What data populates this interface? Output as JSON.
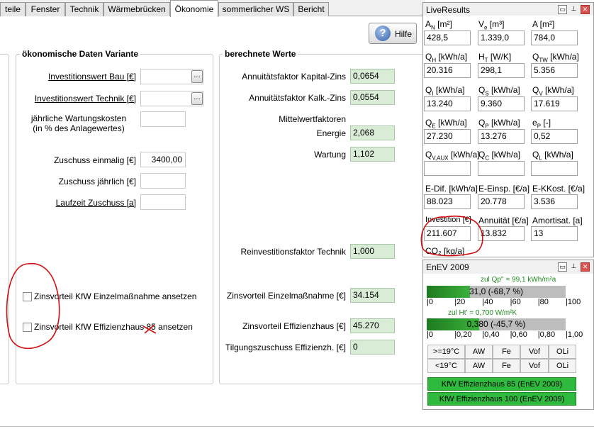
{
  "tabs": [
    "teile",
    "Fenster",
    "Technik",
    "Wärmebrücken",
    "Ökonomie",
    "sommerlicher WS",
    "Bericht"
  ],
  "help_label": "Hilfe",
  "left_group": {
    "title": "ökonomische Daten Variante",
    "investition_bau": {
      "label": "Investitionswert Bau [€]",
      "value": ""
    },
    "investition_technik": {
      "label": "Investitionswert Technik [€]",
      "value": ""
    },
    "wartung": {
      "label_line1": "jährliche Wartungskosten",
      "label_line2": "(in % des Anlagewertes)",
      "value": ""
    },
    "zuschuss_einmalig": {
      "label": "Zuschuss einmalig [€]",
      "value": "3400,00"
    },
    "zuschuss_jaehrlich": {
      "label": "Zuschuss jährlich [€]",
      "value": ""
    },
    "laufzeit": {
      "label": "Laufzeit Zuschuss [a]",
      "value": ""
    },
    "chk_einzel": "Zinsvorteil KfW Einzelmaßnahme ansetzen",
    "chk_effizienz": "Zinsvorteil KfW Effizienzhaus 85 ansetzen"
  },
  "right_group": {
    "title": "berechnete Werte",
    "annuitaet_kapital": {
      "label": "Annuitätsfaktor Kapital-Zins",
      "value": "0,0654"
    },
    "annuitaet_kalk": {
      "label": "Annuitätsfaktor Kalk.-Zins",
      "value": "0,0554"
    },
    "mittelwert_label": "Mittelwertfaktoren",
    "energie": {
      "label": "Energie",
      "value": "2,068"
    },
    "wartung": {
      "label": "Wartung",
      "value": "1,102"
    },
    "reinvest": {
      "label": "Reinvestitionsfaktor Technik",
      "value": "1,000"
    },
    "zins_einzel": {
      "label": "Zinsvorteil Einzelmaßnahme [€]",
      "value": "34.154"
    },
    "zins_effizienz": {
      "label": "Zinsvorteil Effizienzhaus [€]",
      "value": "45.270"
    },
    "tilgung": {
      "label": "Tilgungszuschuss Effizienzh. [€]",
      "value": "0"
    }
  },
  "liveresults": {
    "title": "LiveResults",
    "rows": [
      [
        {
          "label": "A_N [m²]",
          "value": "428,5"
        },
        {
          "label": "V_e [m³]",
          "value": "1.339,0"
        },
        {
          "label": "A [m²]",
          "value": "784,0"
        }
      ],
      [
        {
          "label": "Q_H [kWh/a]",
          "value": "20.316"
        },
        {
          "label": "H_T [W/K]",
          "value": "298,1"
        },
        {
          "label": "Q_TW [kWh/a]",
          "value": "5.356"
        }
      ],
      [
        {
          "label": "Q_I [kWh/a]",
          "value": "13.240"
        },
        {
          "label": "Q_S [kWh/a]",
          "value": "9.360"
        },
        {
          "label": "Q_V [kWh/a]",
          "value": "17.619"
        }
      ],
      [
        {
          "label": "Q_E [kWh/a]",
          "value": "27.230"
        },
        {
          "label": "Q_P [kWh/a]",
          "value": "13.276"
        },
        {
          "label": "e_P [-]",
          "value": "0,52"
        }
      ],
      [
        {
          "label": "Q_V,AUX [kWh/a]",
          "value": ""
        },
        {
          "label": "Q_C [kWh/a]",
          "value": ""
        },
        {
          "label": "Q_L [kWh/a]",
          "value": ""
        }
      ],
      [
        {
          "label": "E-Dif. [kWh/a]",
          "value": "88.023"
        },
        {
          "label": "E-Einsp. [€/a]",
          "value": "20.778"
        },
        {
          "label": "E-KKost. [€/a]",
          "value": "3.536"
        }
      ],
      [
        {
          "label": "Investition [€]",
          "value": "211.607"
        },
        {
          "label": "Annuität [€/a]",
          "value": "13.832"
        },
        {
          "label": "Amortisat. [a]",
          "value": "13"
        }
      ]
    ],
    "co2_label": "CO₂ [kg/a]"
  },
  "enev": {
    "title": "EnEV 2009",
    "qp_caption": "zul Qp'' = 99,1 kWh/m²a",
    "qp_bar_text": "31,0 (-68,7 %)",
    "qp_fraction": 0.31,
    "qp_ticks": [
      "0",
      "20",
      "40",
      "60",
      "80",
      "100"
    ],
    "ht_caption": "zul Ht' = 0,700 W/m²K",
    "ht_bar_text": "0,380 (-45,7 %)",
    "ht_fraction": 0.38,
    "ht_ticks": [
      "0",
      "0,20",
      "0,40",
      "0,60",
      "0,80",
      "1,00"
    ],
    "buttons_row1": [
      ">=19°C",
      "AW",
      "Fe",
      "Vof",
      "OLi"
    ],
    "buttons_row2": [
      "<19°C",
      "AW",
      "Fe",
      "Vof",
      "OLi"
    ],
    "kfw85": "KfW Effizienzhaus 85 (EnEV 2009)",
    "kfw100": "KfW Effizienzhaus 100 (EnEV 2009)"
  }
}
